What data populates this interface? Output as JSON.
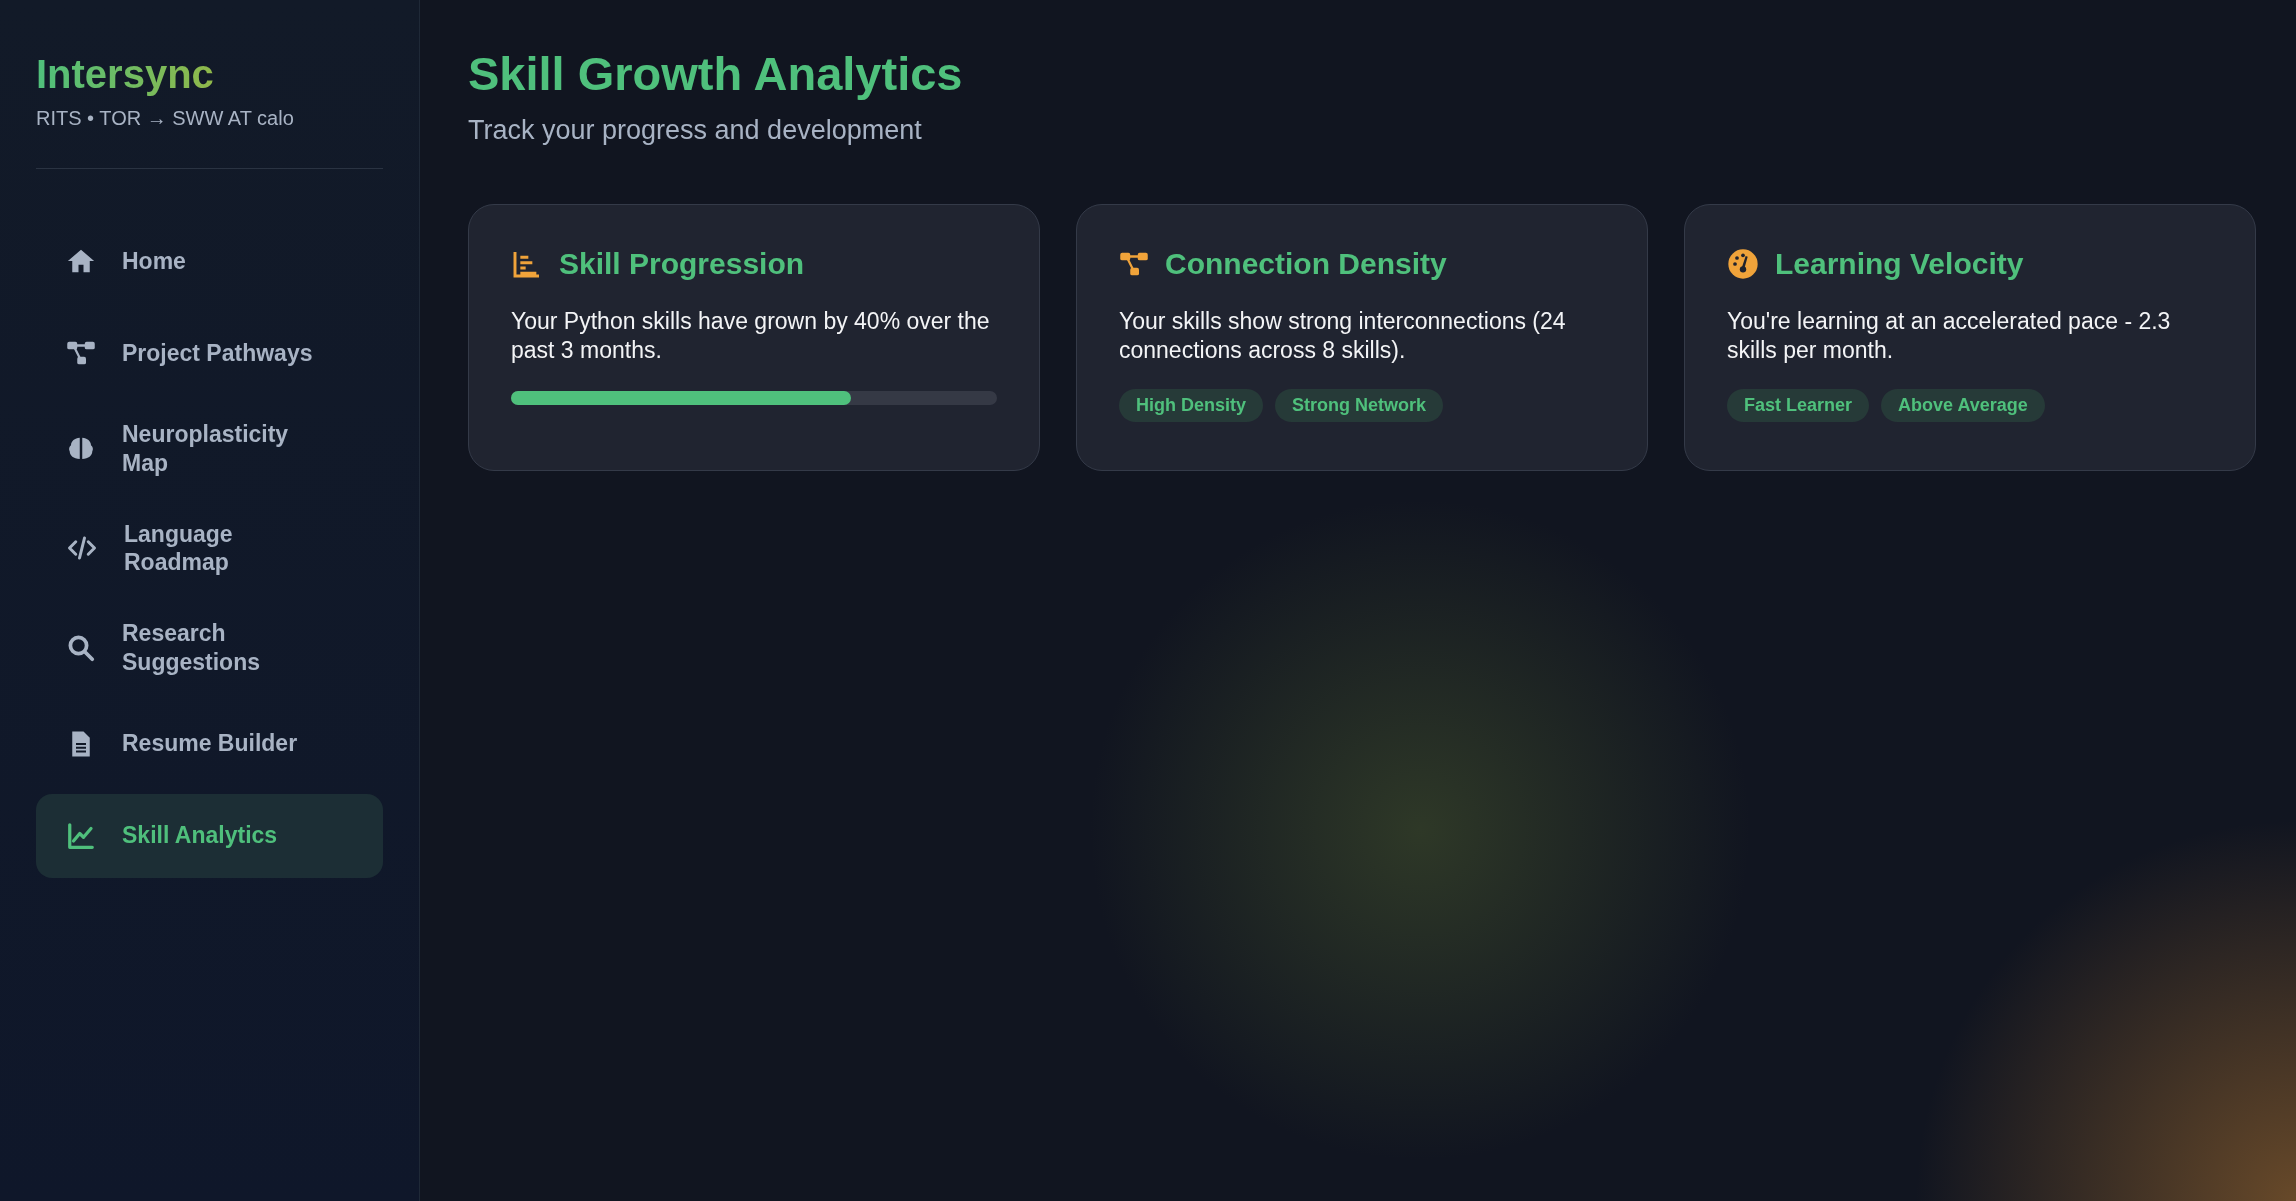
{
  "sidebar": {
    "brand": "Intersync",
    "tagline": "RITS • TOR → SWW AT calo",
    "items": [
      {
        "label": "Home",
        "selected": false
      },
      {
        "label": "Project Pathways",
        "selected": false
      },
      {
        "label": "Neuroplasticity Map",
        "selected": false
      },
      {
        "label": "Language Roadmap",
        "selected": false
      },
      {
        "label": "Research Suggestions",
        "selected": false
      },
      {
        "label": "Resume Builder",
        "selected": false
      },
      {
        "label": "Skill Analytics",
        "selected": true
      }
    ]
  },
  "header": {
    "title": "Skill Growth Analytics",
    "subtitle": "Track your progress and development"
  },
  "cards": [
    {
      "kind": "progress",
      "title": "Skill Progression",
      "text": "Your Python skills have grown by 40% over the past 3 months.",
      "level": 0.7
    },
    {
      "kind": "tags",
      "title": "Connection Density",
      "text": "Your skills show strong interconnections (24 connections across 8 skills).",
      "tags": [
        "High Density",
        "Strong Network"
      ]
    },
    {
      "kind": "tags",
      "title": "Learning Velocity",
      "text": "You're learning at an accelerated pace - 2.3 skills per month.",
      "tags": [
        "Fast Learner",
        "Above Average"
      ]
    }
  ]
}
